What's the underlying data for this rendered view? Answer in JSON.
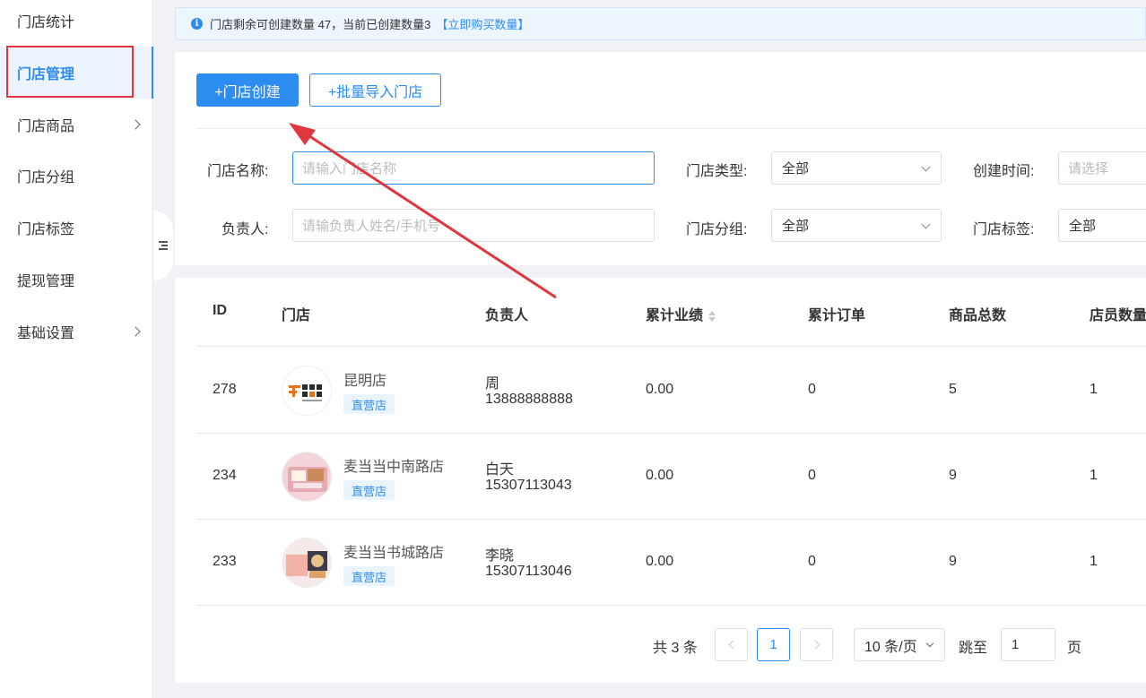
{
  "sidebar": {
    "items": [
      {
        "label": "门店统计",
        "has_children": false
      },
      {
        "label": "门店管理",
        "has_children": false,
        "active": true
      },
      {
        "label": "门店商品",
        "has_children": true
      },
      {
        "label": "门店分组",
        "has_children": false
      },
      {
        "label": "门店标签",
        "has_children": false
      },
      {
        "label": "提现管理",
        "has_children": false
      },
      {
        "label": "基础设置",
        "has_children": true
      }
    ]
  },
  "notice": {
    "text": "门店剩余可创建数量 47，当前已创建数量3",
    "link": "【立即购买数量】"
  },
  "actions": {
    "create": "+门店创建",
    "batch_import": "+批量导入门店"
  },
  "filters": {
    "store_name": {
      "label": "门店名称:",
      "placeholder": "请输入门店名称"
    },
    "store_type": {
      "label": "门店类型:",
      "value": "全部"
    },
    "created_time": {
      "label": "创建时间:",
      "placeholder": "请选择"
    },
    "owner": {
      "label": "负责人:",
      "placeholder": "请输负责人姓名/手机号"
    },
    "store_group": {
      "label": "门店分组:",
      "value": "全部"
    },
    "store_tag": {
      "label": "门店标签:",
      "value": "全部"
    }
  },
  "table": {
    "headers": {
      "id": "ID",
      "store": "门店",
      "owner": "负责人",
      "sales": "累计业绩",
      "orders": "累计订单",
      "products": "商品总数",
      "staff": "店员数量"
    },
    "rows": [
      {
        "id": "278",
        "name": "昆明店",
        "tag": "直营店",
        "owner": "周",
        "phone": "13888888888",
        "sales": "0.00",
        "orders": "0",
        "products": "5",
        "staff": "1"
      },
      {
        "id": "234",
        "name": "麦当当中南路店",
        "tag": "直营店",
        "owner": "白天",
        "phone": "15307113043",
        "sales": "0.00",
        "orders": "0",
        "products": "9",
        "staff": "1"
      },
      {
        "id": "233",
        "name": "麦当当书城路店",
        "tag": "直营店",
        "owner": "李晓",
        "phone": "15307113046",
        "sales": "0.00",
        "orders": "0",
        "products": "9",
        "staff": "1"
      }
    ]
  },
  "pagination": {
    "total": "共 3 条",
    "current": "1",
    "page_size": "10 条/页",
    "jump_label": "跳至",
    "jump_value": "1",
    "page_suffix": "页"
  },
  "colors": {
    "primary": "#2d8cf0",
    "highlight": "#e0373f"
  }
}
